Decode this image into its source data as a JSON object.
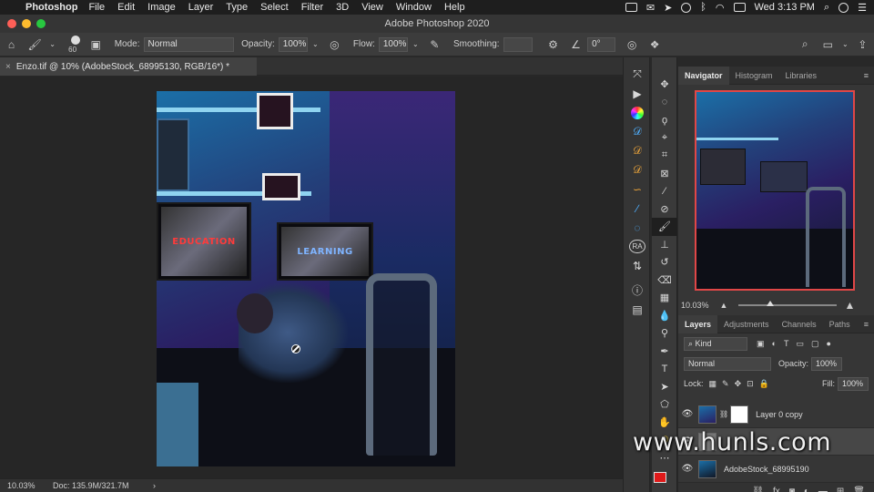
{
  "menubar": {
    "app": "Photoshop",
    "items": [
      "File",
      "Edit",
      "Image",
      "Layer",
      "Type",
      "Select",
      "Filter",
      "3D",
      "View",
      "Window",
      "Help"
    ],
    "clock": "Wed 3:13 PM"
  },
  "window": {
    "title": "Adobe Photoshop 2020"
  },
  "options_bar": {
    "brush_size": "60",
    "mode_label": "Mode:",
    "mode_value": "Normal",
    "opacity_label": "Opacity:",
    "opacity_value": "100%",
    "flow_label": "Flow:",
    "flow_value": "100%",
    "smoothing_label": "Smoothing:",
    "smoothing_value": "",
    "angle_value": "0°"
  },
  "document": {
    "tab_title": "Enzo.tif @ 10% (AdobeStock_68995130, RGB/16*) *",
    "screen_text_left": "EDUCATION",
    "screen_text_right": "LEARNING"
  },
  "statusbar": {
    "zoom": "10.03%",
    "doc": "Doc: 135.9M/321.7M",
    "arrow": "›"
  },
  "navigator_panel": {
    "tabs": [
      "Navigator",
      "Histogram",
      "Libraries"
    ],
    "zoom": "10.03%",
    "zoom_slider_fraction": 0.32
  },
  "layers_panel": {
    "tabs": [
      "Layers",
      "Adjustments",
      "Channels",
      "Paths"
    ],
    "filter_label": "Kind",
    "blend_mode": "Normal",
    "opacity_label": "Opacity:",
    "opacity_value": "100%",
    "lock_label": "Lock:",
    "fill_label": "Fill:",
    "fill_value": "100%",
    "layers": [
      {
        "name": "Layer 0 copy",
        "visible": true
      },
      {
        "name": "",
        "visible": true
      },
      {
        "name": "AdobeStock_68995190",
        "visible": true
      }
    ],
    "footer_icons": [
      "link-icon",
      "fx-icon",
      "mask-icon",
      "adjustment-icon",
      "folder-icon",
      "new-layer-icon",
      "trash-icon"
    ]
  },
  "watermark": "www.hunls.com",
  "colors": {
    "accent_red": "#e04747",
    "foreground_color": "#e01a1a",
    "panel_bg": "#363636",
    "canvas_bg": "#262626"
  }
}
